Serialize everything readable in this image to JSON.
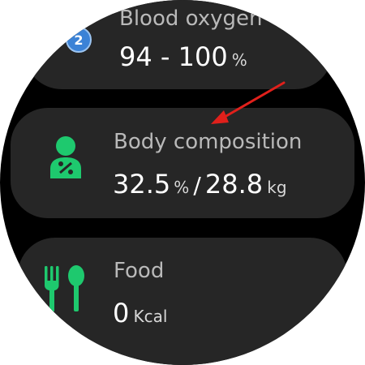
{
  "metrics": {
    "blood_oxygen": {
      "label": "Blood oxygen",
      "value": "94 - 100",
      "unit": "%",
      "badge_number": "2",
      "icon": "blood-oxygen-icon"
    },
    "body_composition": {
      "label": "Body composition",
      "fat_value": "32.5",
      "fat_unit": "%",
      "separator": "/",
      "muscle_value": "28.8",
      "muscle_unit": "kg",
      "icon": "body-composition-icon"
    },
    "food": {
      "label": "Food",
      "value": "0",
      "unit": "Kcal",
      "icon": "food-icon"
    }
  },
  "colors": {
    "accent_green": "#1ec96e",
    "badge_blue": "#3b82d6",
    "arrow_red": "#e0201b",
    "card_bg": "#262626"
  }
}
